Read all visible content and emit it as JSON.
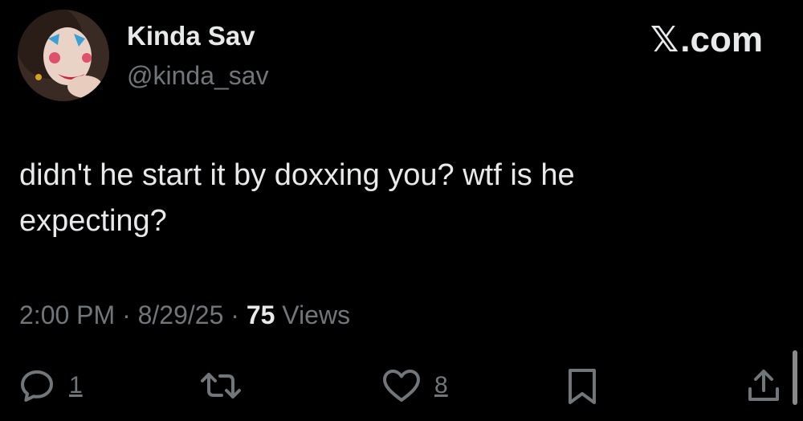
{
  "author": {
    "display_name": "Kinda Sav",
    "handle": "@kinda_sav",
    "avatar": "avatar-photo"
  },
  "brand": {
    "x_glyph": "𝕏",
    "domain": ".com"
  },
  "tweet": {
    "text": "didn't he start it by doxxing you? wtf is he expecting?"
  },
  "meta": {
    "time": "2:00 PM",
    "separator_1": " · ",
    "date": "8/29/25",
    "separator_2": " · ",
    "views_count": "75",
    "views_label": " Views"
  },
  "actions": {
    "reply": {
      "icon": "reply-icon",
      "count": "1"
    },
    "retweet": {
      "icon": "retweet-icon"
    },
    "like": {
      "icon": "heart-icon",
      "count": "8"
    },
    "bookmark": {
      "icon": "bookmark-icon"
    },
    "share": {
      "icon": "share-icon"
    }
  },
  "colors": {
    "background": "#000000",
    "primary_text": "#e7e9ea",
    "secondary_text": "#71767b"
  }
}
